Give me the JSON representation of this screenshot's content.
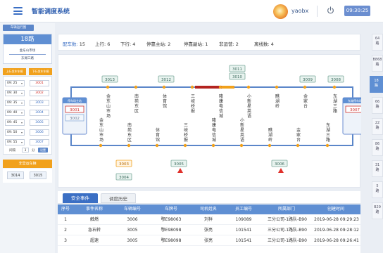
{
  "header": {
    "title": "智能调度系统",
    "username": "yaobx",
    "time": "09:30:25"
  },
  "left": {
    "top_tag": "车辆运行图",
    "route": {
      "name": "18路",
      "from": "金东山市场",
      "to": "东湖三路"
    },
    "up_header": "上行发车车辆",
    "down_header": "下行发车车辆",
    "schedule": [
      {
        "time": "09: 25",
        "bus": "3001"
      },
      {
        "time": "09: 30",
        "bus": "3002"
      },
      {
        "time": "09: 35",
        "bus": "3003"
      },
      {
        "time": "09: 40",
        "bus": "3004"
      },
      {
        "time": "09: 45",
        "bus": "3005"
      },
      {
        "time": "09: 50",
        "bus": "3006"
      },
      {
        "time": "09: 55",
        "bus": "3007"
      }
    ],
    "interval_label": "间隔",
    "interval_value": "3",
    "interval_unit": "分",
    "interval_button": "设置",
    "nonop_header": "非营运车辆",
    "nonop_buses": [
      "3014",
      "3015"
    ]
  },
  "stats": {
    "vehicles_label": "配车数:",
    "vehicles": "15",
    "up_label": "上行:",
    "up": "6",
    "down_label": "下行:",
    "down": "4",
    "main_label": "停靠主站:",
    "main": "2",
    "sub_label": "停靠副站:",
    "sub": "1",
    "nonop_label": "非运营:",
    "nonop": "2",
    "offline_label": "离线数:",
    "offline": "4"
  },
  "map": {
    "main_station": "停车场主站",
    "sub_station": "东湖停车场",
    "up_stops": [
      "金东山市场",
      "南苑东区",
      "体育馆",
      "三岐桥报",
      "隆康电信城",
      "小新星英语",
      "瞧湖岭",
      "金家台",
      "东湖三路"
    ],
    "down_stops": [
      "金东山市场",
      "南苑东区",
      "体育馆",
      "三岐桥报",
      "隆康电信城",
      "小新星英语",
      "瞧湖岭",
      "金家台",
      "东湖三路"
    ],
    "up_buses": [
      "3013",
      "3012",
      "3011",
      "3010",
      "3009",
      "3008"
    ],
    "down_buses": [
      "3003",
      "3004",
      "3005",
      "3006"
    ],
    "main_buses": [
      "3001",
      "3002"
    ],
    "sub_buses": [
      "3007"
    ],
    "colors": {
      "line": "#5b86c9",
      "congested": "#b3231f",
      "slow": "#f1a11c",
      "stop": "#f1a11c",
      "alert": "#e0302a"
    }
  },
  "tabs": {
    "safety": "安全事件",
    "history": "调度历史"
  },
  "table": {
    "headers": [
      "序号",
      "事件名称",
      "车辆编号",
      "车牌号",
      "司机姓名",
      "员工编号",
      "所属部门",
      "创建时间"
    ],
    "rows": [
      [
        "1",
        "触燃",
        "3006",
        "鄂E98063",
        "刘祥",
        "109089",
        "三分公司-1路队-B90",
        "2019-06-28 09:29:23"
      ],
      [
        "2",
        "急右转",
        "3005",
        "鄂E98098",
        "张亮",
        "101541",
        "三分公司-1路队-B90",
        "2019-06-28 09:28:12"
      ],
      [
        "3",
        "超速",
        "3005",
        "鄂E98098",
        "张亮",
        "101541",
        "三分公司-1路队-B90",
        "2019-06-28 09:26:41"
      ]
    ]
  },
  "route_tabs": [
    "64路",
    "B868路",
    "18路",
    "66路",
    "22路",
    "86路",
    "31路",
    "5路",
    "B29路"
  ],
  "active_route_tab": "18路"
}
